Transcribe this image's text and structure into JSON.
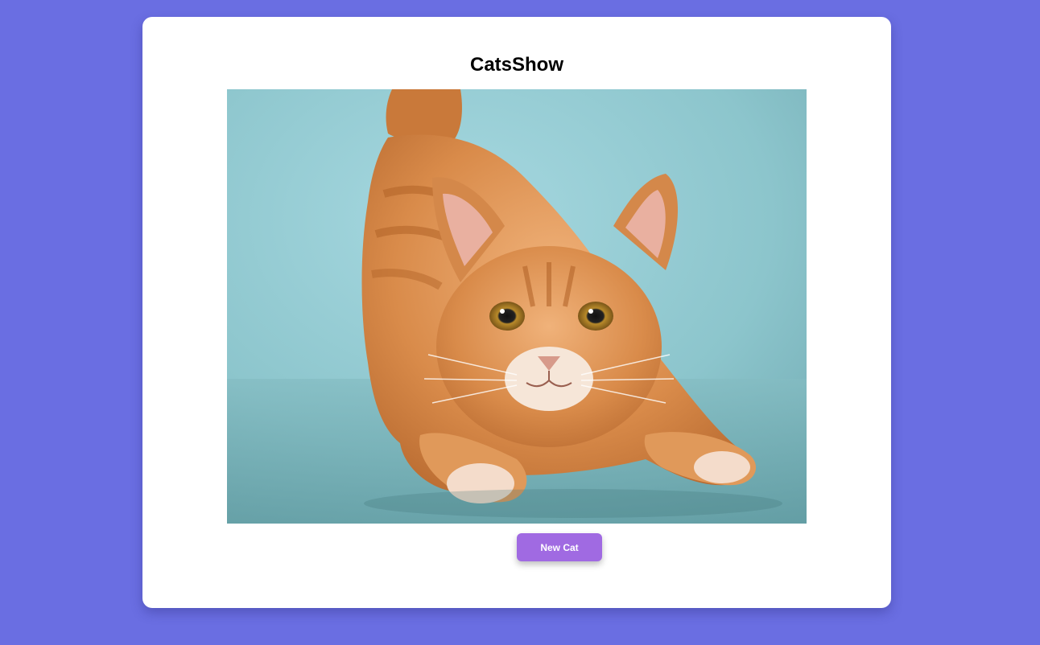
{
  "app": {
    "title": "CatsShow"
  },
  "image": {
    "subject": "orange-tabby-cat"
  },
  "actions": {
    "new_cat_label": "New Cat"
  },
  "colors": {
    "page_background": "#6a6ee2",
    "card_background": "#ffffff",
    "button_background": "#a06ae2",
    "button_text": "#ffffff"
  }
}
